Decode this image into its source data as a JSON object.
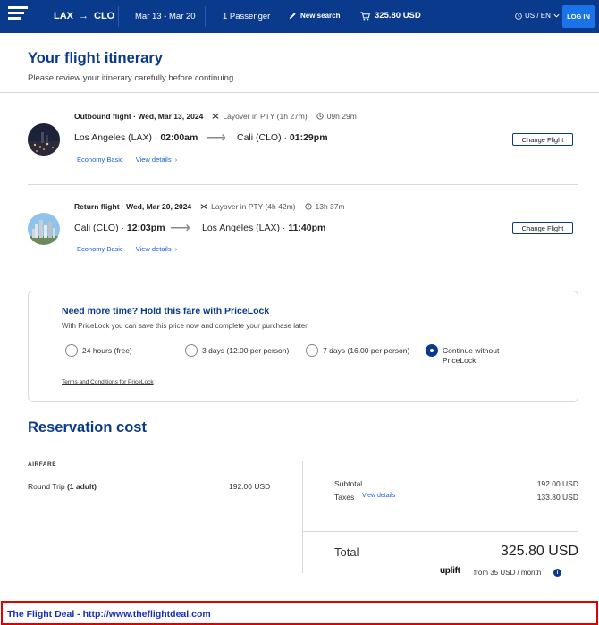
{
  "header": {
    "origin": "LAX",
    "destination": "CLO",
    "route_arrow": "→",
    "dates": "Mar 13 - Mar 20",
    "passengers": "1 Passenger",
    "new_search": "New search",
    "cart_total": "325.80 USD",
    "locale": "US / EN",
    "login": "LOG IN"
  },
  "page": {
    "title": "Your flight itinerary",
    "subtitle": "Please review your itinerary carefully before continuing."
  },
  "flights": [
    {
      "label": "Outbound flight · Wed, Mar 13, 2024",
      "layover": "Layover in PTY (1h 27m)",
      "duration": "09h 29m",
      "from_city": "Los Angeles (LAX) · ",
      "from_time": "02:00am",
      "to_city": "Cali (CLO) · ",
      "to_time": "01:29pm",
      "fare": "Economy Basic",
      "details": "View details",
      "change": "Change Flight"
    },
    {
      "label": "Return flight · Wed, Mar 20, 2024",
      "layover": "Layover in PTY (4h 42m)",
      "duration": "13h 37m",
      "from_city": "Cali (CLO) · ",
      "from_time": "12:03pm",
      "to_city": "Los Angeles (LAX) · ",
      "to_time": "11:40pm",
      "fare": "Economy Basic",
      "details": "View details",
      "change": "Change Flight"
    }
  ],
  "pricelock": {
    "title": "Need more time? Hold this fare with PriceLock",
    "subtitle": "With PriceLock you can save this price now and complete your purchase later.",
    "options": [
      {
        "label": "24 hours (free)",
        "selected": false
      },
      {
        "label": "3 days (12.00 per person)",
        "selected": false
      },
      {
        "label": "7 days (16.00 per person)",
        "selected": false
      },
      {
        "label": "Continue without PriceLock",
        "selected": true
      }
    ],
    "terms": "Terms and Conditions for PriceLock"
  },
  "cost": {
    "title": "Reservation cost",
    "section_label": "AIRFARE",
    "trip_label": "Round Trip",
    "trip_adults": " (1 adult)",
    "trip_amount": "192.00 USD",
    "subtotal_label": "Subtotal",
    "subtotal_amount": "192.00 USD",
    "taxes_label": "Taxes",
    "taxes_link": "View details",
    "taxes_amount": "133.80 USD",
    "total_label": "Total",
    "total_amount": "325.80 USD",
    "uplift_brand": "uplift",
    "uplift_text": "from 35 USD  / month",
    "info_icon": "i"
  },
  "footer": {
    "text": "The Flight Deal - http://www.theflightdeal.com"
  },
  "colors": {
    "brand_navy": "#0a3a8c",
    "link_blue": "#1a5fd0",
    "login_blue": "#1a73e8",
    "footer_border": "#e00000",
    "footer_text": "#1a2fb8"
  }
}
